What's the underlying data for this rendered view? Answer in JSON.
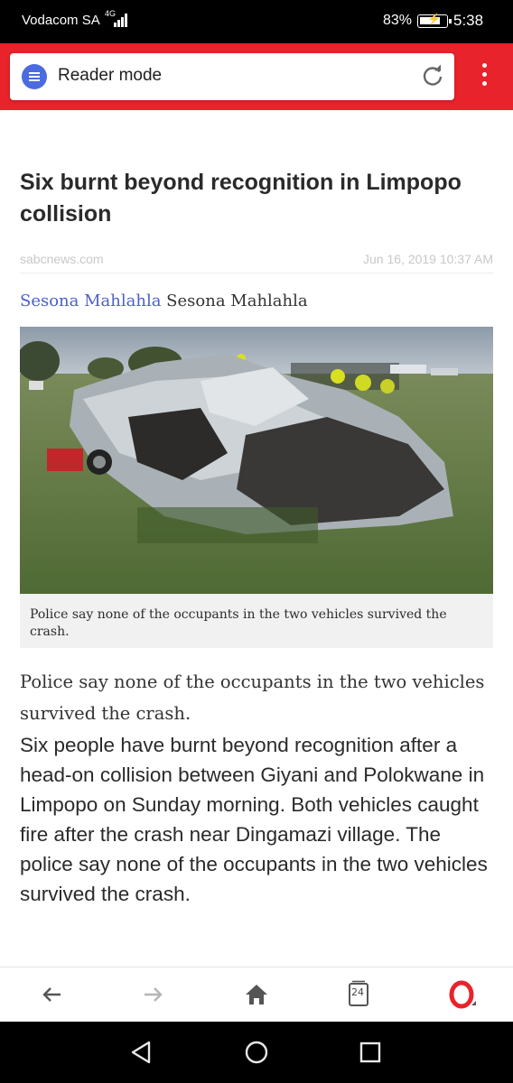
{
  "status_bar": {
    "carrier": "Vodacom SA",
    "network": "4G",
    "battery_percent": "83%",
    "battery_level": 0.83,
    "time": "5:38"
  },
  "browser": {
    "url_bar_text": "Reader mode",
    "accent_color": "#e8232b",
    "tab_count": "24",
    "icons": [
      "reader-mode-icon",
      "reload-icon",
      "overflow-menu-icon",
      "back-arrow-icon",
      "forward-arrow-icon",
      "home-icon",
      "tabs-icon",
      "opera-menu-icon"
    ]
  },
  "article": {
    "title": "Six burnt beyond recognition in Limpopo collision",
    "source": "sabcnews.com",
    "date": "Jun 16, 2019 10:37 AM",
    "author_link": "Sesona Mahlahla",
    "author_name": "Sesona Mahlahla",
    "image_caption": "Police say none of the occupants in the two vehicles survived the crash.",
    "lede": "Police say none of the occupants in the two vehicles survived the crash.",
    "body": "Six people have burnt beyond recognition after a head-on collision between Giyani and Polokwane in Limpopo on Sunday morning. Both vehicles caught fire after the crash near Dingamazi village. The police say none of the occupants in the two vehicles survived the crash."
  },
  "system_nav": {
    "icons": [
      "nav-back-icon",
      "nav-home-icon",
      "nav-recents-icon"
    ]
  }
}
